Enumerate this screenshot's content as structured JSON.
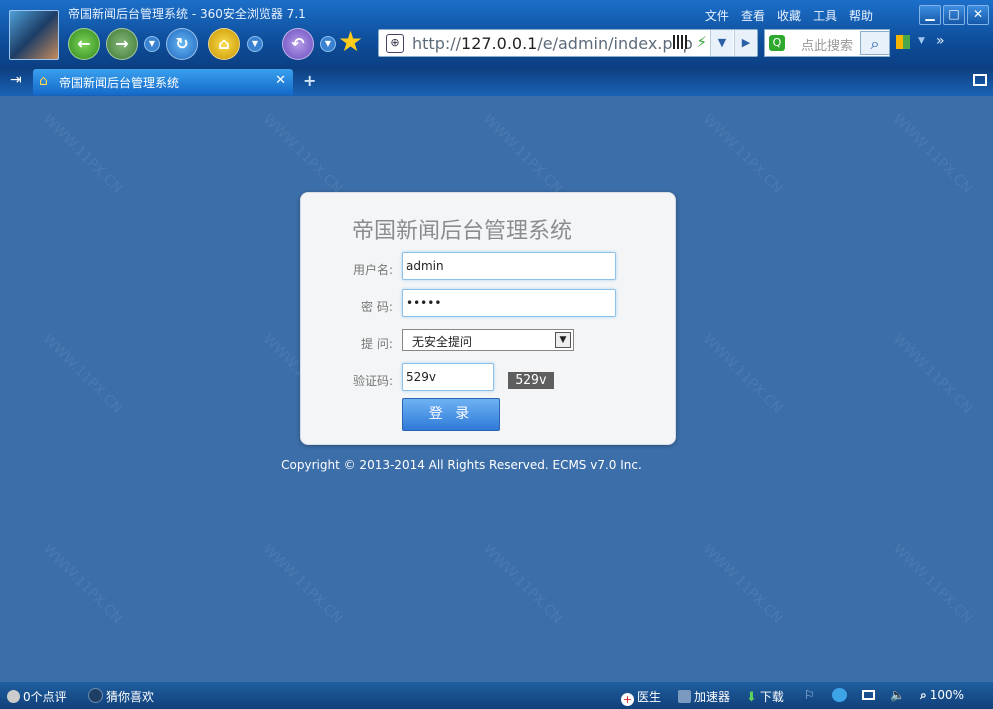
{
  "browser": {
    "window_title": "帝国新闻后台管理系统 - 360安全浏览器 7.1",
    "menu": [
      "文件",
      "查看",
      "收藏",
      "工具",
      "帮助"
    ],
    "url_host": "http://",
    "url_main": "127.0.0.1",
    "url_path": "/e/admin/index.php",
    "search_placeholder": "点此搜索",
    "tab_title": "帝国新闻后台管理系统",
    "new_tab": "+",
    "window_buttons": [
      "▁",
      "□",
      "✕"
    ]
  },
  "login": {
    "title": "帝国新闻后台管理系统",
    "username_label": "用户名:",
    "username_value": "admin",
    "password_label": "密 码:",
    "password_value": "•••••",
    "question_label": "提 问:",
    "question_value": "无安全提问",
    "captcha_label": "验证码:",
    "captcha_input": "529v",
    "captcha_image_text": "529v",
    "submit_label": "登 录"
  },
  "footer": {
    "copyright": "Copyright © 2013-2014 All Rights Reserved. ECMS v7.0 Inc."
  },
  "statusbar": {
    "comments": "0个点评",
    "guess": "猜你喜欢",
    "doctor": "医生",
    "accelerator": "加速器",
    "download": "下载",
    "zoom": "100%"
  },
  "watermark_text": "WWW.11PX.CN",
  "colors": {
    "background": "#3c6ea9",
    "titlebar": "#0e4e9b",
    "panel": "#f4f5f6",
    "button": "#2f7ad8"
  }
}
